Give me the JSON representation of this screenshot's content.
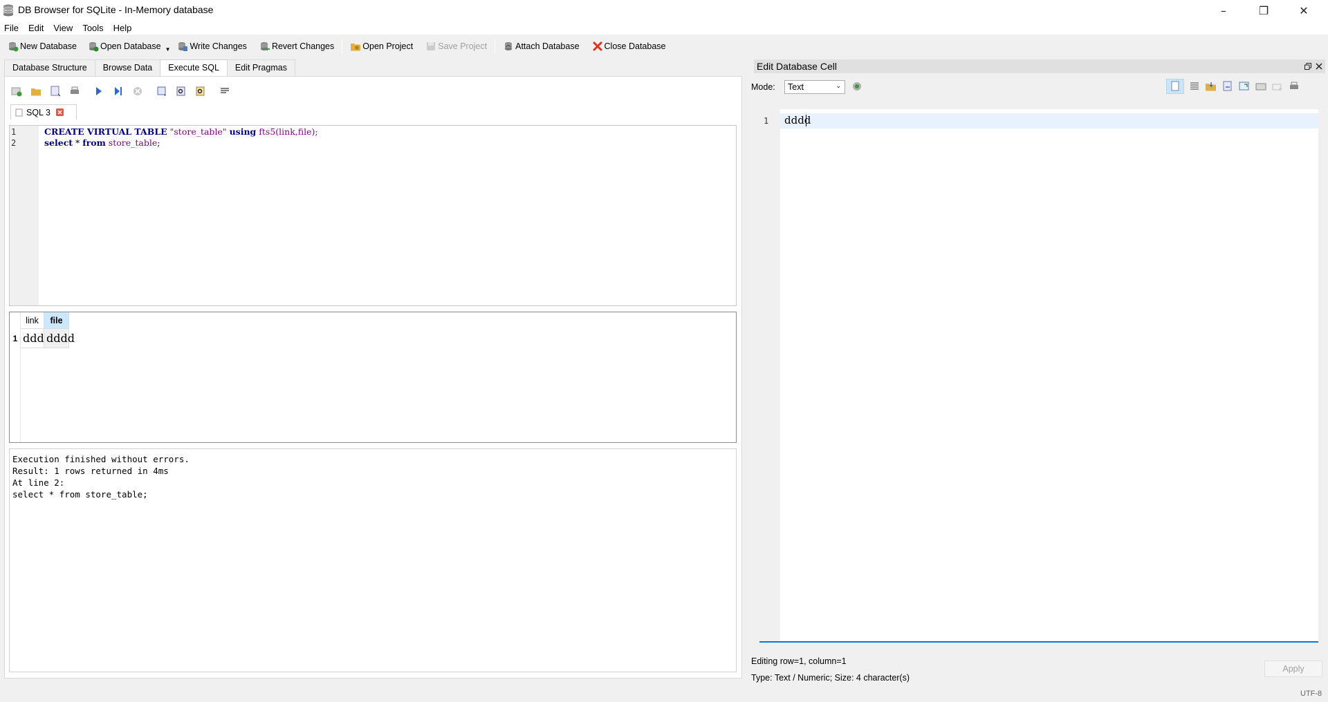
{
  "window": {
    "title": "DB Browser for SQLite - In-Memory database",
    "minimize": "–",
    "restore": "❐",
    "close": "✕"
  },
  "menu": [
    "File",
    "Edit",
    "View",
    "Tools",
    "Help"
  ],
  "toolbar": {
    "new_database": "New Database",
    "open_database": "Open Database",
    "write_changes": "Write Changes",
    "revert_changes": "Revert Changes",
    "open_project": "Open Project",
    "save_project": "Save Project",
    "attach_database": "Attach Database",
    "close_database": "Close Database"
  },
  "tabs": [
    "Database Structure",
    "Browse Data",
    "Execute SQL",
    "Edit Pragmas"
  ],
  "active_tab": "Execute SQL",
  "sql_tab": {
    "label": "SQL 3"
  },
  "editor": {
    "line_numbers": [
      "1",
      "2"
    ],
    "line1": {
      "kw1": "CREATE VIRTUAL TABLE",
      "str": "\"store_table\"",
      "kw2": "using",
      "fn": "fts5",
      "args": "(link,file);"
    },
    "line2": {
      "kw1": "select",
      "op": " * ",
      "kw2": "from",
      "tbl": "store_table",
      "end": ";"
    }
  },
  "results": {
    "columns": [
      "link",
      "file"
    ],
    "rows": [
      {
        "rownum": "1",
        "link": "ddd",
        "file": "dddd"
      }
    ]
  },
  "messages": {
    "text": "Execution finished without errors.\nResult: 1 rows returned in 4ms\nAt line 2:\nselect * from store_table;"
  },
  "edit_cell": {
    "title": "Edit Database Cell",
    "mode_label": "Mode:",
    "mode_value": "Text",
    "line_number": "1",
    "content": "dddd",
    "editing_info": "Editing row=1, column=1",
    "type_info": "Type: Text / Numeric; Size: 4 character(s)",
    "apply_label": "Apply"
  },
  "statusbar": {
    "encoding": "UTF-8"
  },
  "colors": {
    "accent": "#0078d7",
    "keyword": "#000080",
    "string": "#7f007f",
    "header_selected": "#cce8ff"
  }
}
